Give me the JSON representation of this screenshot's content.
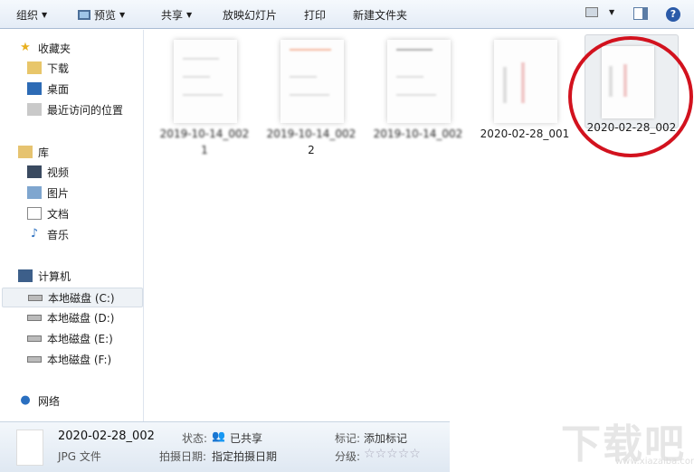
{
  "toolbar": {
    "organize": "组织",
    "preview": "预览",
    "share": "共享",
    "slideshow": "放映幻灯片",
    "print": "打印",
    "new_folder": "新建文件夹"
  },
  "sidebar": {
    "favorites": {
      "label": "收藏夹",
      "items": [
        "下载",
        "桌面",
        "最近访问的位置"
      ]
    },
    "libraries": {
      "label": "库",
      "items": [
        "视频",
        "图片",
        "文档",
        "音乐"
      ]
    },
    "computer": {
      "label": "计算机",
      "items": [
        "本地磁盘 (C:)",
        "本地磁盘 (D:)",
        "本地磁盘 (E:)",
        "本地磁盘 (F:)"
      ]
    },
    "network": {
      "label": "网络"
    }
  },
  "files": [
    {
      "name": "2019-10-14_002",
      "line2": "1"
    },
    {
      "name": "2019-10-14_002",
      "line2": "2"
    },
    {
      "name": "2019-10-14_002",
      "line2": ""
    },
    {
      "name": "2020-02-28_001",
      "line2": ""
    },
    {
      "name": "2020-02-28_002",
      "line2": ""
    }
  ],
  "details": {
    "name": "2020-02-28_002",
    "type": "JPG 文件",
    "status_label": "状态:",
    "status": "已共享",
    "date_label": "拍摄日期:",
    "date": "指定拍摄日期",
    "tags_label": "标记:",
    "tags": "添加标记",
    "rating_label": "分级:",
    "rating": 0,
    "rating_max": 5
  },
  "watermark": {
    "text": "下载吧",
    "url": "www.xiazaiba.com"
  },
  "colors": {
    "highlight_circle": "#d2121e"
  }
}
